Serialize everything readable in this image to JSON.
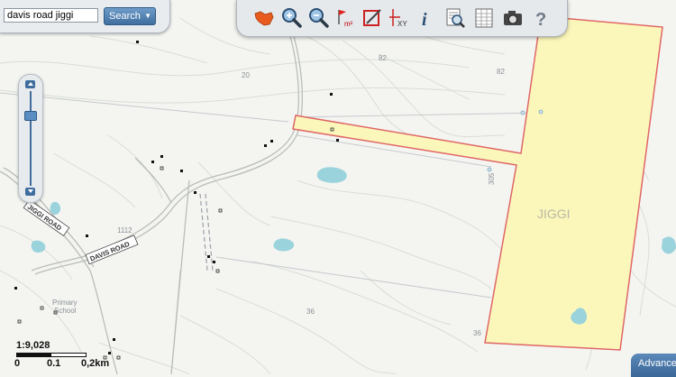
{
  "search": {
    "value": "davis road jiggi",
    "button_label": "Search"
  },
  "toolbar": {
    "tools": [
      {
        "name": "basemap-icon"
      },
      {
        "name": "zoom-in-icon"
      },
      {
        "name": "zoom-out-icon"
      },
      {
        "name": "measure-area-icon"
      },
      {
        "name": "measure-length-icon"
      },
      {
        "name": "xy-coordinate-icon"
      },
      {
        "name": "info-icon"
      },
      {
        "name": "print-preview-icon"
      },
      {
        "name": "table-icon"
      },
      {
        "name": "camera-icon"
      },
      {
        "name": "help-icon"
      }
    ]
  },
  "map": {
    "place_label": "JIGGI",
    "road_labels": [
      "JIGGI ROAD",
      "DAVIS ROAD"
    ],
    "school_label": [
      "Primary",
      "School"
    ],
    "spot_heights": [
      "82",
      "82",
      "20",
      "1112",
      "36",
      "36",
      "305"
    ],
    "parcel_fill": "#fbf7bb",
    "parcel_stroke": "#e06666",
    "water_color": "#9ad3dc"
  },
  "scale": {
    "ratio": "1:9,028",
    "ticks": [
      "0",
      "0.1",
      "0,2km"
    ]
  },
  "advanced_label": "Advanced"
}
